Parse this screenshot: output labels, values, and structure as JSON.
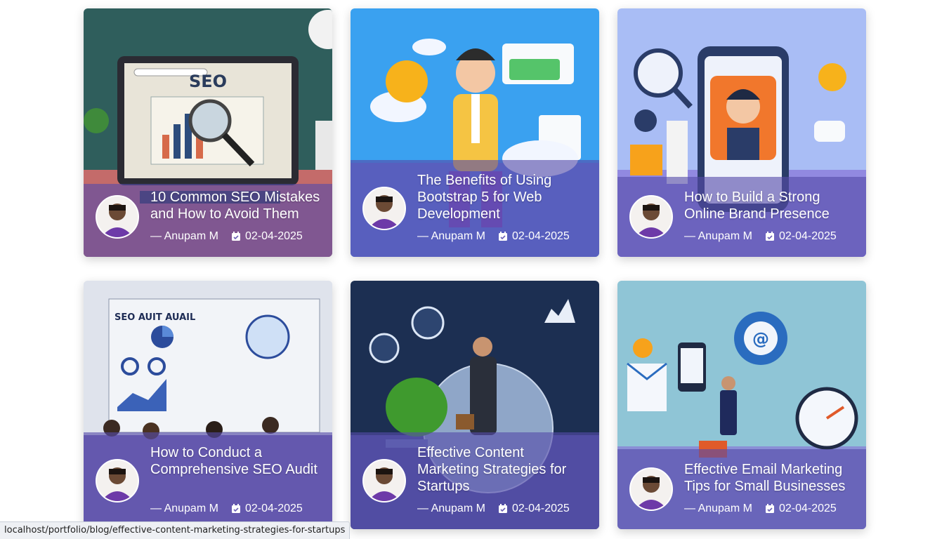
{
  "posts": [
    {
      "title": "10 Common SEO Mistakes and How to Avoid Them",
      "author": "— Anupam M",
      "date": "02-04-2025"
    },
    {
      "title": "The Benefits of Using Bootstrap 5 for Web Development",
      "author": "— Anupam M",
      "date": "02-04-2025"
    },
    {
      "title": "How to Build a Strong Online Brand Presence",
      "author": "— Anupam M",
      "date": "02-04-2025"
    },
    {
      "title": "How to Conduct a Comprehensive SEO Audit",
      "author": "— Anupam M",
      "date": "02-04-2025"
    },
    {
      "title": "Effective Content Marketing Strategies for Startups",
      "author": "— Anupam M",
      "date": "02-04-2025"
    },
    {
      "title": "Effective Email Marketing Tips for Small Businesses",
      "author": "— Anupam M",
      "date": "02-04-2025"
    }
  ],
  "card_images": [
    {
      "label": "SEO"
    },
    {
      "label": ""
    },
    {
      "label": ""
    },
    {
      "label": "SEO AUIT AUAIL"
    },
    {
      "label": ""
    },
    {
      "label": ""
    }
  ],
  "status_bar": {
    "url": "localhost/portfolio/blog/effective-content-marketing-strategies-for-startups"
  }
}
